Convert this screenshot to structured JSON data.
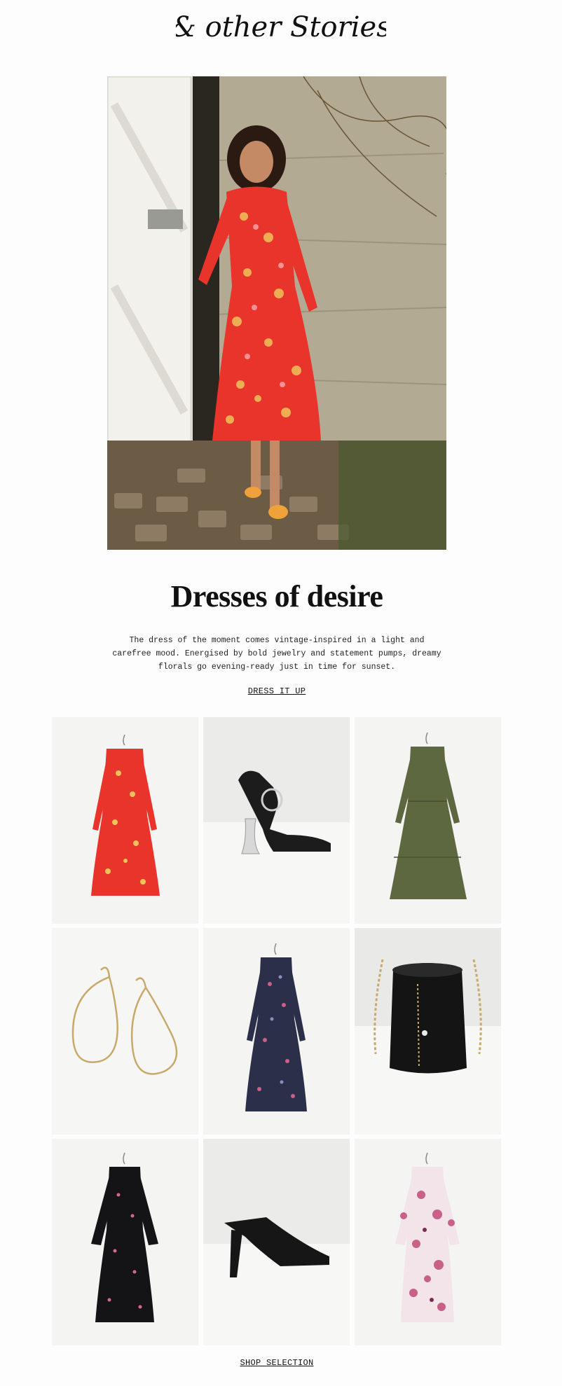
{
  "brand": {
    "logo_text": "& other Stories"
  },
  "hero": {
    "image_alt": "Model in red floral midi dress by white barn door"
  },
  "editorial": {
    "headline": "Dresses of desire",
    "body_lines": [
      "The dress of the moment comes vintage-inspired in a light and",
      "carefree mood. Energised by bold jewelry and statement pumps, dreamy",
      "florals go evening-ready just in time for sunset."
    ],
    "cta_primary": "DRESS IT UP",
    "cta_secondary": "SHOP SELECTION"
  },
  "products": [
    {
      "name": "red-floral-midi-dress",
      "icon": "red-floral-dress"
    },
    {
      "name": "black-buckle-heel-sandal",
      "icon": "black-sandal"
    },
    {
      "name": "khaki-midi-dress",
      "icon": "khaki-dress"
    },
    {
      "name": "gold-wire-earrings",
      "icon": "gold-earrings"
    },
    {
      "name": "navy-floral-dress",
      "icon": "navy-floral-dress"
    },
    {
      "name": "black-bucket-bag",
      "icon": "black-bucket-bag"
    },
    {
      "name": "black-floral-wrap-dress",
      "icon": "black-floral-dress"
    },
    {
      "name": "black-mule-heel",
      "icon": "black-mule"
    },
    {
      "name": "pink-floral-dress",
      "icon": "pink-floral-dress"
    }
  ],
  "colors": {
    "accent_red": "#e8342a",
    "khaki": "#5e6840",
    "navy": "#2c2f4a",
    "pink": "#c86088",
    "gold": "#c9a96a"
  }
}
